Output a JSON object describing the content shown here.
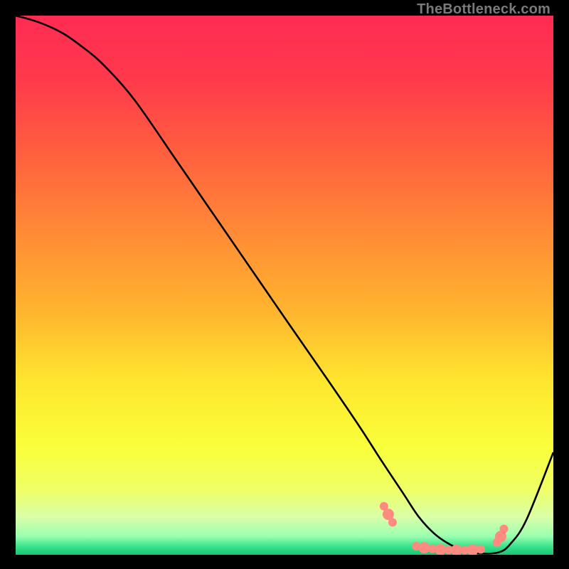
{
  "watermark": "TheBottleneck.com",
  "chart_data": {
    "type": "line",
    "title": "",
    "xlabel": "",
    "ylabel": "",
    "xrange": [
      0,
      100
    ],
    "ylim": [
      0,
      100
    ],
    "gradient_stops": [
      {
        "pos": 0.0,
        "color": "#ff2b53"
      },
      {
        "pos": 0.12,
        "color": "#ff3a4c"
      },
      {
        "pos": 0.25,
        "color": "#ff5e3f"
      },
      {
        "pos": 0.4,
        "color": "#ff8a36"
      },
      {
        "pos": 0.55,
        "color": "#ffb52f"
      },
      {
        "pos": 0.68,
        "color": "#ffe62f"
      },
      {
        "pos": 0.8,
        "color": "#f9ff3a"
      },
      {
        "pos": 0.88,
        "color": "#efff66"
      },
      {
        "pos": 0.93,
        "color": "#d9ffa8"
      },
      {
        "pos": 0.965,
        "color": "#9dffb0"
      },
      {
        "pos": 0.985,
        "color": "#37e28a"
      },
      {
        "pos": 1.0,
        "color": "#18c574"
      }
    ],
    "series": [
      {
        "name": "bottleneck-curve",
        "x": [
          0,
          3,
          6,
          9,
          12,
          16,
          22,
          30,
          40,
          50,
          58,
          64,
          68,
          72,
          75,
          78,
          81,
          84,
          87,
          90,
          92,
          95,
          100
        ],
        "values": [
          100,
          99.2,
          98.1,
          96.6,
          94.5,
          91.2,
          84.5,
          73.0,
          58.5,
          44.0,
          32.5,
          23.7,
          17.5,
          11.5,
          7.0,
          3.8,
          1.8,
          0.6,
          0.2,
          0.5,
          2.0,
          6.5,
          19.0
        ]
      }
    ],
    "markers": {
      "name": "highlight-dots",
      "color": "#ff8a80",
      "points": [
        {
          "x": 68.5,
          "y": 9.0,
          "r": 6
        },
        {
          "x": 69.3,
          "y": 7.5,
          "r": 8
        },
        {
          "x": 70.1,
          "y": 6.0,
          "r": 6
        },
        {
          "x": 74.5,
          "y": 1.6,
          "r": 6
        },
        {
          "x": 76.0,
          "y": 1.3,
          "r": 8
        },
        {
          "x": 77.5,
          "y": 1.1,
          "r": 6
        },
        {
          "x": 79.0,
          "y": 1.0,
          "r": 8
        },
        {
          "x": 80.5,
          "y": 0.9,
          "r": 6
        },
        {
          "x": 82.0,
          "y": 0.85,
          "r": 8
        },
        {
          "x": 83.5,
          "y": 0.85,
          "r": 6
        },
        {
          "x": 85.0,
          "y": 0.9,
          "r": 8
        },
        {
          "x": 86.5,
          "y": 1.0,
          "r": 6
        },
        {
          "x": 89.5,
          "y": 2.3,
          "r": 6
        },
        {
          "x": 90.2,
          "y": 3.4,
          "r": 8
        },
        {
          "x": 90.8,
          "y": 4.8,
          "r": 6
        }
      ]
    }
  }
}
